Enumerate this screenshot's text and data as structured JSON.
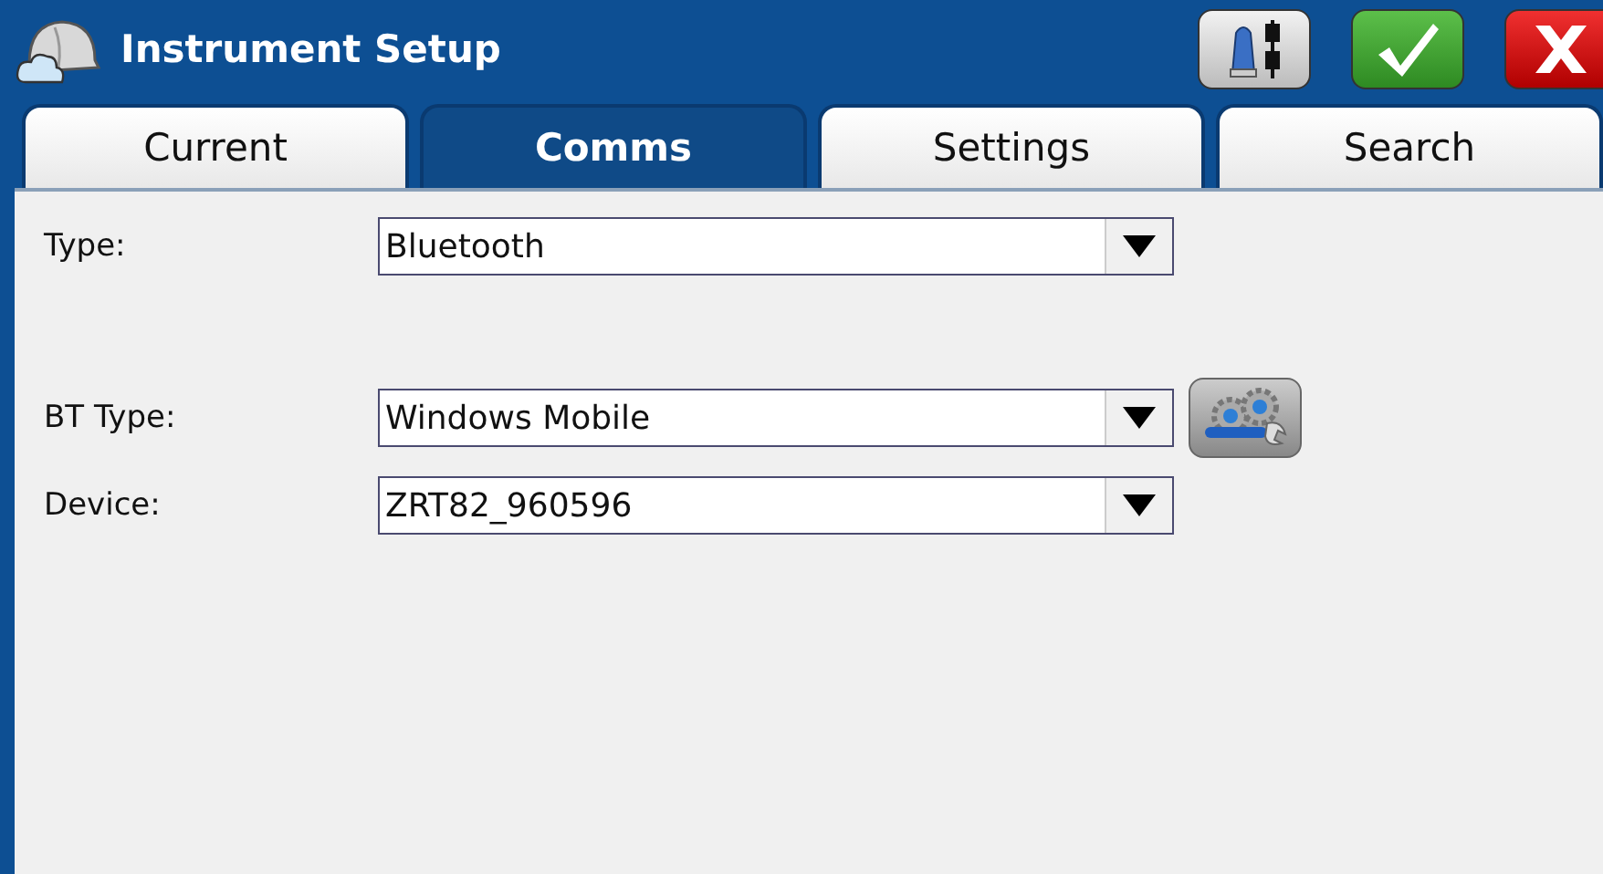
{
  "window": {
    "title": "Instrument Setup"
  },
  "tabs": [
    {
      "label": "Current",
      "selected": false
    },
    {
      "label": "Comms",
      "selected": true
    },
    {
      "label": "Settings",
      "selected": false
    },
    {
      "label": "Search",
      "selected": false
    }
  ],
  "groups": [
    {
      "fields": [
        {
          "label": "Type:",
          "value": "Bluetooth",
          "kind": "dropdown"
        }
      ]
    },
    {
      "fields": [
        {
          "label": "BT Type:",
          "value": "Windows Mobile",
          "kind": "dropdown-with-settings"
        },
        {
          "label": "Device:",
          "value": "ZRT82_960596",
          "kind": "dropdown"
        }
      ]
    }
  ]
}
